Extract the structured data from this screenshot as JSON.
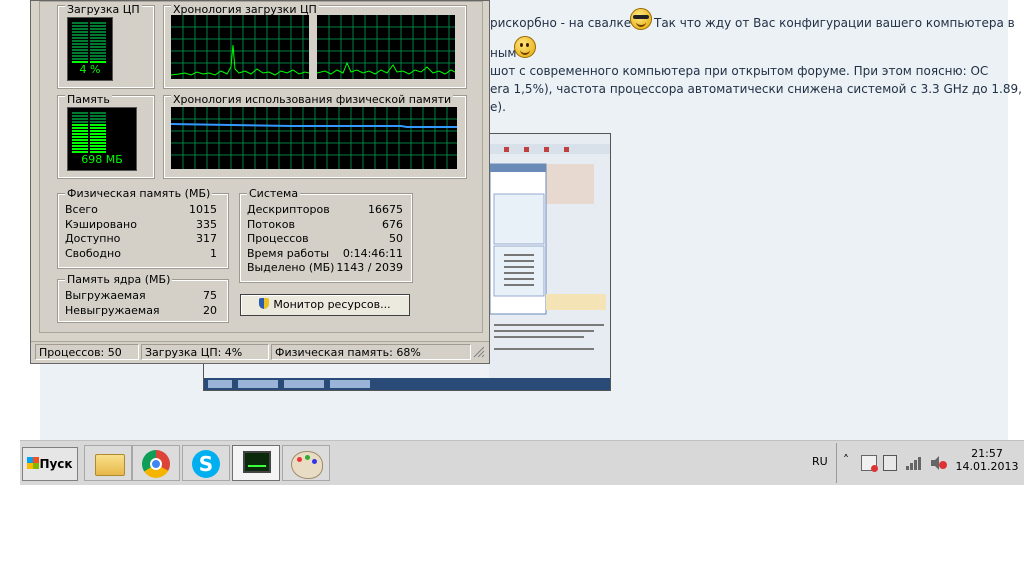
{
  "forum": {
    "line1": "рискорбно - на свалке",
    "line1b": "Так что жду от Вас конфигурации вашего компьютера в",
    "line2": "ным",
    "line3": "шот с современного компьютера при открытом форуме. При этом поясню: ОС",
    "line4": "era 1,5%), частота процессора автоматически снижена системой с 3.3 GHz до 1.89,",
    "line5": "e)."
  },
  "taskmgr": {
    "cpu_usage_title": "Загрузка ЦП",
    "cpu_usage_value": "4 %",
    "cpu_history_title": "Хронология загрузки ЦП",
    "memory_title": "Память",
    "memory_value": "698 МБ",
    "mem_history_title": "Хронология использования физической памяти",
    "physical": {
      "title": "Физическая память (МБ)",
      "rows": [
        {
          "k": "Всего",
          "v": "1015"
        },
        {
          "k": "Кэшировано",
          "v": "335"
        },
        {
          "k": "Доступно",
          "v": "317"
        },
        {
          "k": "Свободно",
          "v": "1"
        }
      ]
    },
    "kernel": {
      "title": "Память ядра (МБ)",
      "rows": [
        {
          "k": "Выгружаемая",
          "v": "75"
        },
        {
          "k": "Невыгружаемая",
          "v": "20"
        }
      ]
    },
    "system": {
      "title": "Система",
      "rows": [
        {
          "k": "Дескрипторов",
          "v": "16675"
        },
        {
          "k": "Потоков",
          "v": "676"
        },
        {
          "k": "Процессов",
          "v": "50"
        },
        {
          "k": "Время работы",
          "v": "0:14:46:11"
        },
        {
          "k": "Выделено (МБ)",
          "v": "1143 / 2039"
        }
      ]
    },
    "resource_monitor_button": "Монитор ресурсов...",
    "status": {
      "processes": "Процессов: 50",
      "cpu": "Загрузка ЦП: 4%",
      "memory": "Физическая память: 68%"
    },
    "cpu_fraction": 0.04,
    "memory_fraction": 0.68
  },
  "taskbar": {
    "start_label": "Пуск",
    "language": "RU",
    "time": "21:57",
    "date": "14.01.2013"
  },
  "colors": {
    "graph_grid": "#008040",
    "cpu_line": "#00ff00",
    "mem_line": "#3399ff"
  }
}
